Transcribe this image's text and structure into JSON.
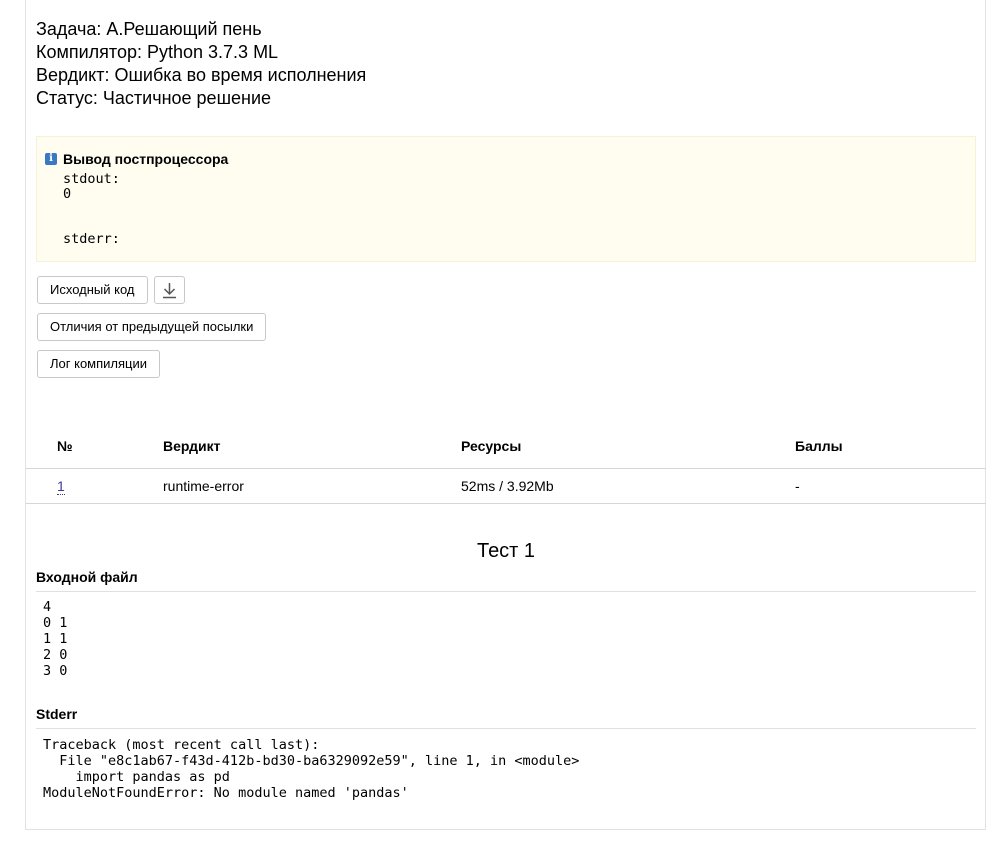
{
  "info": {
    "task": "Задача: А.Решающий пень",
    "compiler": "Компилятор: Python 3.7.3 ML",
    "verdict": "Вердикт: Ошибка во время исполнения",
    "status": "Статус: Частичное решение"
  },
  "postprocessor": {
    "icon": "info-icon",
    "title": "Вывод постпроцессора",
    "stdout_label": "stdout:",
    "stdout_value": "0",
    "stderr_label": "stderr:"
  },
  "buttons": {
    "source_code": "Исходный код",
    "download_icon": "download-icon",
    "diff_previous": "Отличия от предыдущей посылки",
    "compile_log": "Лог компиляции"
  },
  "table": {
    "headers": [
      "№",
      "Вердикт",
      "Ресурсы",
      "Баллы"
    ],
    "rows": [
      {
        "num": "1",
        "verdict": "runtime-error",
        "resources": "52ms / 3.92Mb",
        "score": "-"
      }
    ]
  },
  "test": {
    "title": "Тест 1",
    "input_label": "Входной файл",
    "input_content": "4\n0 1\n1 1\n2 0\n3 0",
    "stderr_label": "Stderr",
    "stderr_content": "Traceback (most recent call last):\n  File \"e8c1ab67-f43d-412b-bd30-ba6329092e59\", line 1, in <module>\n    import pandas as pd\nModuleNotFoundError: No module named 'pandas'"
  }
}
